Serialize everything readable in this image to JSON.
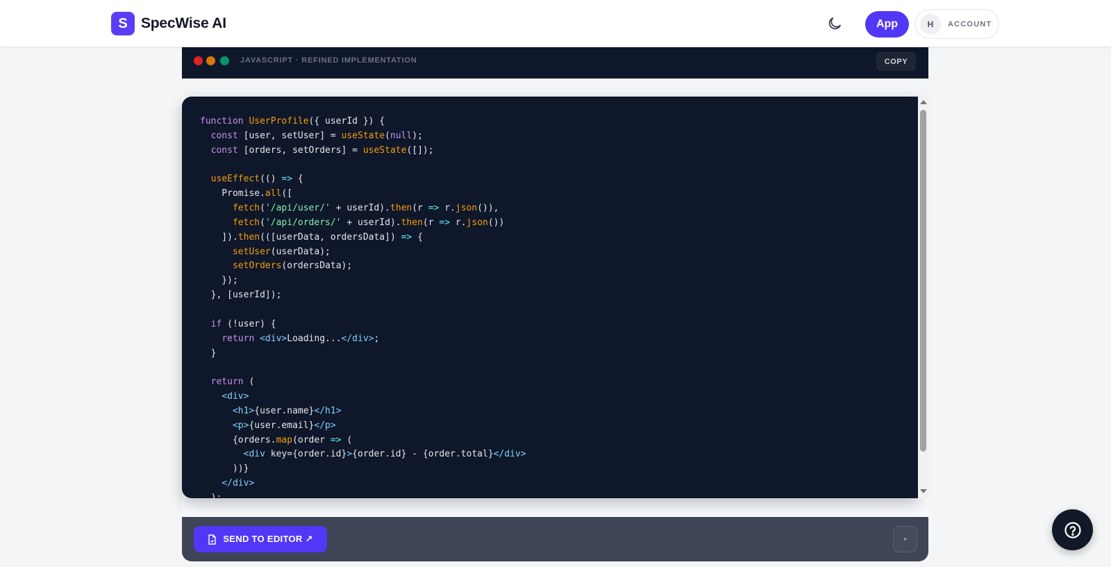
{
  "header": {
    "brand_initial": "S",
    "brand_name": "SpecWise AI",
    "app_label": "App",
    "account_initial": "H",
    "account_label": "ACCOUNT"
  },
  "code_panel": {
    "language_label": "JAVASCRIPT · REFINED IMPLEMENTATION",
    "copy_label": "COPY",
    "code": "function UserProfile({ userId }) {\n  const [user, setUser] = useState(null);\n  const [orders, setOrders] = useState([]);\n\n  useEffect(() => {\n    Promise.all([\n      fetch('/api/user/' + userId).then(r => r.json()),\n      fetch('/api/orders/' + userId).then(r => r.json())\n    ]).then(([userData, ordersData]) => {\n      setUser(userData);\n      setOrders(ordersData);\n    });\n  }, [userId]);\n\n  if (!user) {\n    return <div>Loading...</div>;\n  }\n\n  return (\n    <div>\n      <h1>{user.name}</h1>\n      <p>{user.email}</p>\n      {orders.map(order => (\n        <div key={order.id}>{order.id} - {order.total}</div>\n      ))}\n    </div>\n  );\n}"
  },
  "actions": {
    "send_label": "SEND TO EDITOR ↗",
    "dropdown_glyph": "▾"
  },
  "icons": {
    "theme": "moon-icon",
    "send": "file-icon",
    "help": "help-icon"
  },
  "colors": {
    "accent": "#5138f6",
    "code_bg": "#0f172a",
    "keyword": "#c792ea",
    "function": "#f59e0b",
    "string": "#86efac"
  }
}
